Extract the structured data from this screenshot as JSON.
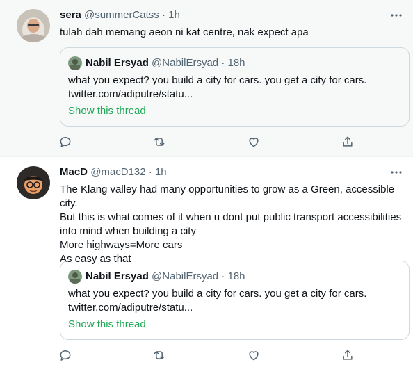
{
  "tweets": [
    {
      "author_name": "sera",
      "author_handle": "@summerCatss",
      "separator": "·",
      "time": "1h",
      "text": "tulah dah memang aeon ni kat centre, nak expect apa",
      "quote": {
        "author_name": "Nabil Ersyad",
        "author_handle": "@NabilErsyad",
        "separator": "·",
        "time": "18h",
        "text": "what you expect? you build a city for cars. you get a city for cars.",
        "link": "twitter.com/adiputre/statu...",
        "show_thread": "Show this thread"
      },
      "actions": [
        "reply-icon",
        "retweet-icon",
        "like-icon",
        "share-icon"
      ]
    },
    {
      "author_name": "MacD",
      "author_handle": "@macD132",
      "separator": "·",
      "time": "1h",
      "text_lines": [
        "The Klang valley had many opportunities to grow as a Green, accessible city.",
        "But this is what comes of it when u dont put public transport accessibilities",
        "into mind when building a city",
        "More highways=More cars",
        "As easy as that"
      ],
      "quote": {
        "author_name": "Nabil Ersyad",
        "author_handle": "@NabilErsyad",
        "separator": "·",
        "time": "18h",
        "text": "what you expect? you build a city for cars. you get a city for cars.",
        "link": "twitter.com/adiputre/statu...",
        "show_thread": "Show this thread"
      },
      "actions": [
        "reply-icon",
        "retweet-icon",
        "like-icon",
        "share-icon"
      ]
    }
  ],
  "colors": {
    "highlight_bg": "#f7f9f9",
    "secondary_text": "#536471",
    "show_thread": "#1fa855",
    "border": "#cfd9de"
  },
  "more_icon": "more-options-icon"
}
